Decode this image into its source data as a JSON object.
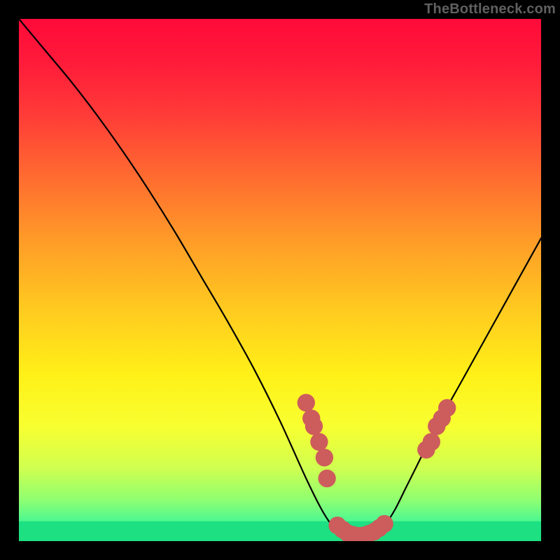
{
  "watermark": "TheBottleneck.com",
  "chart_data": {
    "type": "line",
    "title": "",
    "xlabel": "",
    "ylabel": "",
    "xlim": [
      0,
      100
    ],
    "ylim": [
      0,
      100
    ],
    "series": [
      {
        "name": "curve",
        "x": [
          0,
          5,
          10,
          15,
          20,
          25,
          30,
          35,
          40,
          45,
          50,
          55,
          58,
          60,
          62,
          64,
          66,
          68,
          70,
          72,
          74,
          76,
          80,
          85,
          90,
          95,
          100
        ],
        "values": [
          100,
          94,
          88,
          81.5,
          74.5,
          67,
          59,
          50.5,
          42,
          33,
          23,
          12,
          6,
          3,
          1.5,
          1,
          1,
          1.5,
          3,
          6,
          10,
          14,
          22,
          31,
          40,
          49,
          58
        ]
      }
    ],
    "markers": {
      "name": "highlight-dots",
      "color": "#cd5c5c",
      "radius_pct": 1.7,
      "points": [
        {
          "x": 55,
          "y": 26.5
        },
        {
          "x": 56,
          "y": 23.5
        },
        {
          "x": 56.5,
          "y": 22
        },
        {
          "x": 57.5,
          "y": 19
        },
        {
          "x": 58.5,
          "y": 16
        },
        {
          "x": 59,
          "y": 12
        },
        {
          "x": 61,
          "y": 3
        },
        {
          "x": 62,
          "y": 2.2
        },
        {
          "x": 63,
          "y": 1.5
        },
        {
          "x": 64,
          "y": 1.2
        },
        {
          "x": 65,
          "y": 1
        },
        {
          "x": 66,
          "y": 1.1
        },
        {
          "x": 67,
          "y": 1.4
        },
        {
          "x": 68,
          "y": 1.8
        },
        {
          "x": 69,
          "y": 2.5
        },
        {
          "x": 70,
          "y": 3.3
        },
        {
          "x": 78,
          "y": 17.5
        },
        {
          "x": 79,
          "y": 19
        },
        {
          "x": 80,
          "y": 22
        },
        {
          "x": 81,
          "y": 23.5
        },
        {
          "x": 82,
          "y": 25.5
        }
      ]
    },
    "gradient_stops": [
      {
        "offset": 0,
        "color": "#ff0a3a"
      },
      {
        "offset": 0.08,
        "color": "#ff1a3a"
      },
      {
        "offset": 0.18,
        "color": "#ff3a38"
      },
      {
        "offset": 0.3,
        "color": "#ff6a30"
      },
      {
        "offset": 0.42,
        "color": "#ff9a28"
      },
      {
        "offset": 0.55,
        "color": "#ffc820"
      },
      {
        "offset": 0.68,
        "color": "#fff018"
      },
      {
        "offset": 0.78,
        "color": "#f8ff30"
      },
      {
        "offset": 0.86,
        "color": "#d0ff50"
      },
      {
        "offset": 0.92,
        "color": "#90ff70"
      },
      {
        "offset": 0.96,
        "color": "#50f890"
      },
      {
        "offset": 1.0,
        "color": "#1de082"
      }
    ],
    "green_band": {
      "top_pct": 96.2,
      "bottom_pct": 100
    }
  }
}
